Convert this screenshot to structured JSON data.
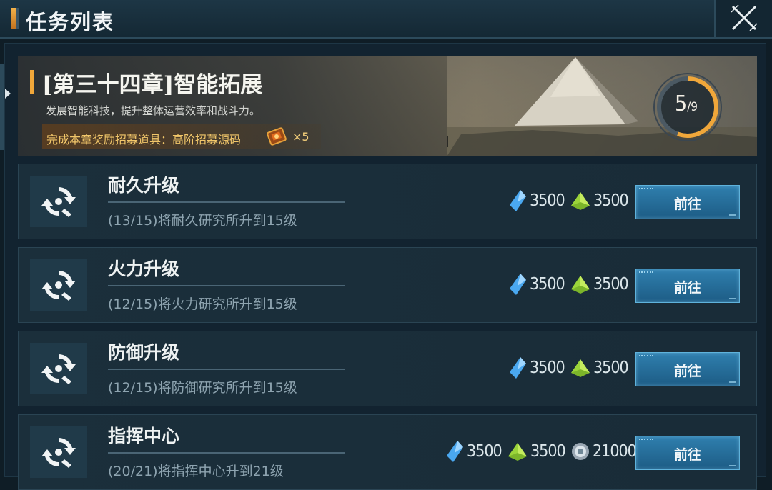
{
  "header": {
    "title": "任务列表",
    "close_icon": "close-x-icon"
  },
  "chapter": {
    "title": "[第三十四章]智能拓展",
    "description": "发展智能科技，提升整体运营效率和战斗力。",
    "reward_label": "完成本章奖励招募道具：高阶招募源码",
    "reward_qty": "×5",
    "progress_current": "5",
    "progress_total": "/9",
    "progress_fraction": 0.556
  },
  "button_label": "前往",
  "tasks": [
    {
      "name": "耐久升级",
      "desc": "(13/15)将耐久研究所升到15级",
      "res1": "3500",
      "res2": "3500",
      "res3": ""
    },
    {
      "name": "火力升级",
      "desc": "(12/15)将火力研究所升到15级",
      "res1": "3500",
      "res2": "3500",
      "res3": ""
    },
    {
      "name": "防御升级",
      "desc": "(12/15)将防御研究所升到15级",
      "res1": "3500",
      "res2": "3500",
      "res3": ""
    },
    {
      "name": "指挥中心",
      "desc": "(20/21)将指挥中心升到21级",
      "res1": "3500",
      "res2": "3500",
      "res3": "21000"
    }
  ],
  "colors": {
    "accent_orange": "#f0a73a",
    "button_blue": "#2f7fae",
    "crystal_blue": "#4aa8f0",
    "ore_green": "#9bd43a"
  }
}
